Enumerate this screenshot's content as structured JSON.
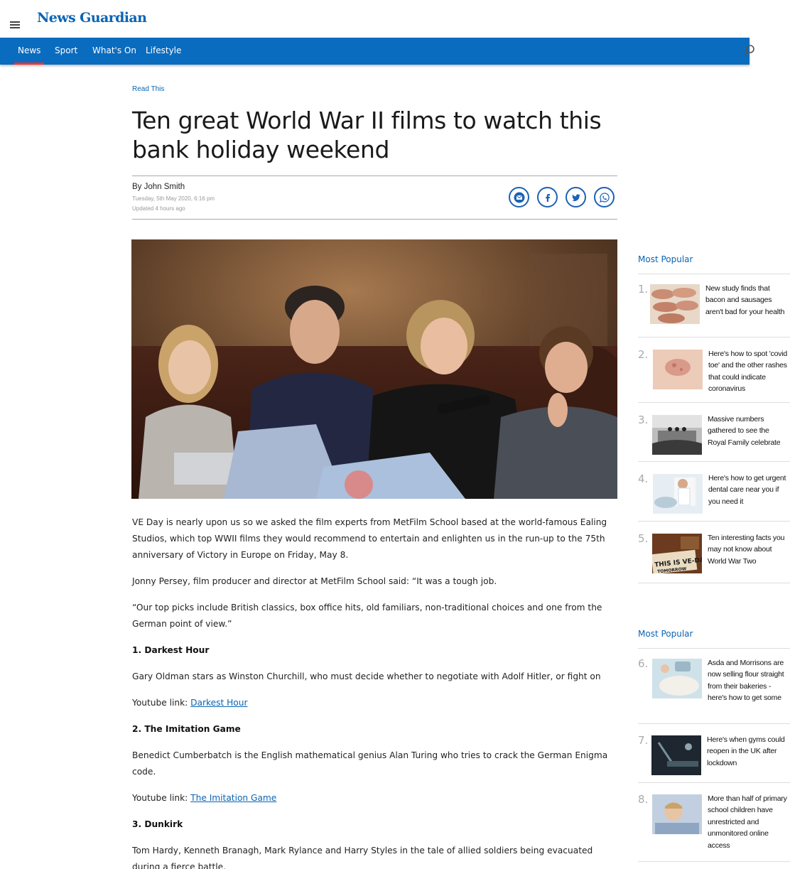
{
  "site": {
    "logo": "News Guardian"
  },
  "nav": {
    "items": [
      {
        "label": "News"
      },
      {
        "label": "Sport"
      },
      {
        "label": "What's On"
      },
      {
        "label": "Lifestyle"
      }
    ]
  },
  "article": {
    "eyebrow": "Read This",
    "headline": "Ten great World War II films to watch this bank holiday weekend",
    "byline": "By John Smith",
    "published": "Tuesday, 5th May 2020, 6:16 pm",
    "updated": "Updated  4 hours ago",
    "paragraphs": {
      "p1": "VE Day is nearly upon us so we asked the film experts from MetFilm School based at the world-famous Ealing Studios, which top WWII films they would recommend to entertain and enlighten us in the run-up to the 75th anniversary of Victory in Europe on Friday, May 8.",
      "p2": "Jonny Persey, film producer and director at MetFilm School said: “It was a tough job.",
      "p3": "“Our top picks include British classics, box office hits, old familiars, non-traditional choices and one from the German point of view.”",
      "h1": "1. Darkest Hour",
      "p4": "Gary Oldman stars as Winston Churchill, who must decide whether to negotiate with Adolf Hitler, or fight on",
      "yt_label": "Youtube link: ",
      "link1": "Darkest Hour",
      "h2": "2. The Imitation Game",
      "p5": "Benedict Cumberbatch is the English mathematical genius Alan Turing who tries to crack the German Enigma code.",
      "link2": "The Imitation Game",
      "h3": "3. Dunkirk",
      "p6": "Tom Hardy, Kenneth Branagh, Mark Rylance and Harry Styles in the tale of allied soldiers being evacuated during a fierce battle."
    }
  },
  "sidebar": {
    "block1": {
      "title": "Most Popular",
      "items": [
        {
          "num": "1.",
          "text": "New study finds that bacon and sausages aren't bad for your health"
        },
        {
          "num": "2.",
          "text": "Here's how to spot 'covid toe' and the other rashes that could indicate coronavirus"
        },
        {
          "num": "3.",
          "text": "Massive numbers gathered to see the Royal Family celebrate"
        },
        {
          "num": "4.",
          "text": "Here's how to get urgent dental care near you if you need it"
        },
        {
          "num": "5.",
          "text": "Ten interesting facts you may not know about World War Two"
        }
      ]
    },
    "block2": {
      "title": "Most Popular",
      "items": [
        {
          "num": "6.",
          "text": "Asda and Morrisons are now selling flour straight from their bakeries - here's how to get some"
        },
        {
          "num": "7.",
          "text": "Here's when gyms could reopen in the UK after lockdown"
        },
        {
          "num": "8.",
          "text": "More than half of primary school children have unrestricted and unmonitored online access"
        }
      ]
    }
  },
  "thumb5_text": {
    "line1": "THIS IS VE-DAY",
    "line2": "TOMORROW"
  },
  "colors": {
    "brand": "#0a6cbf",
    "link": "#0a64b3",
    "active": "#ee3333"
  }
}
